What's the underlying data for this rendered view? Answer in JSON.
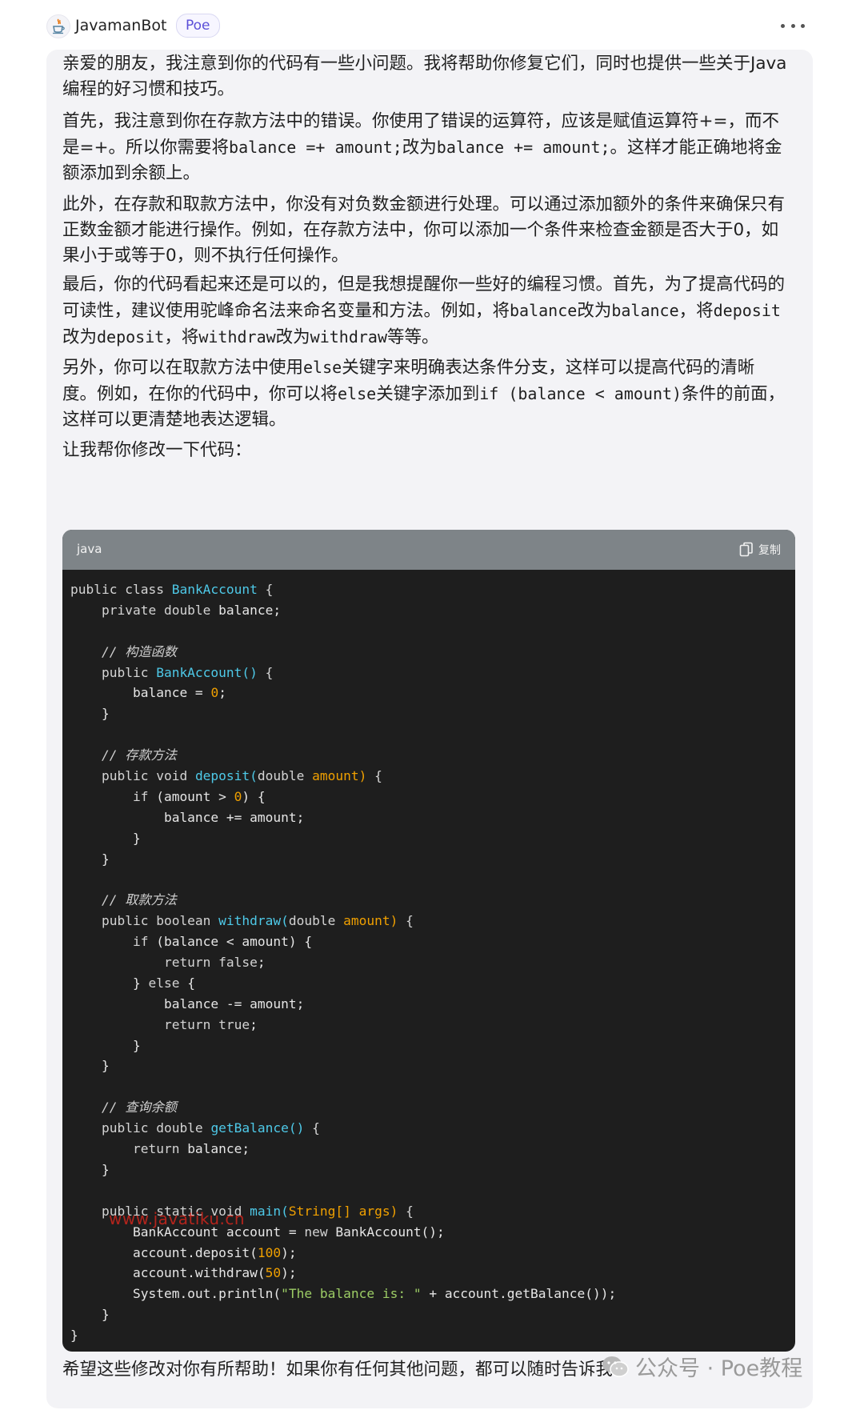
{
  "header": {
    "bot_name": "JavamanBot",
    "badge": "Poe"
  },
  "message": {
    "paragraphs": [
      [
        "亲爱的朋友，我注意到你的代码有一些小问题。我将帮助你修复它们，同时也提供一些关于Java编程的好习惯和技巧。"
      ],
      [
        "首先，我注意到你在存款方法中的错误。你使用了错误的运算符，应该是赋值运算符+=，而不是=+。所以你需要将",
        "balance =+ amount;",
        "改为",
        "balance += amount;",
        "。这样才能正确地将金额添加到余额上。"
      ],
      [
        "此外，在存款和取款方法中，你没有对负数金额进行处理。可以通过添加额外的条件来确保只有正数金额才能进行操作。例如，在存款方法中，你可以添加一个条件来检查金额是否大于0，如果小于或等于0，则不执行任何操作。"
      ],
      [
        "最后，你的代码看起来还是可以的，但是我想提醒你一些好的编程习惯。首先，为了提高代码的可读性，建议使用驼峰命名法来命名变量和方法。例如，将",
        "balance",
        "改为",
        "balance",
        "，将",
        "deposit",
        "改为",
        "deposit",
        "，将",
        "withdraw",
        "改为",
        "withdraw",
        "等等。"
      ],
      [
        "另外，你可以在取款方法中使用",
        "else",
        "关键字来明确表达条件分支，这样可以提高代码的清晰度。例如，在你的代码中，你可以将",
        "else",
        "关键字添加到",
        "if (balance < amount)",
        "条件的前面，这样可以更清楚地表达逻辑。"
      ],
      [
        "让我帮你修改一下代码："
      ],
      [
        "希望这些修改对你有所帮助！如果你有任何其他问题，都可以随时告诉我。"
      ]
    ]
  },
  "code": {
    "language": "java",
    "copy_label": "复制",
    "lines": [
      [
        [
          "kw",
          "public class "
        ],
        [
          "fn",
          "BankAccount"
        ],
        [
          "kw",
          " {"
        ]
      ],
      [
        [
          "kw",
          "    private double "
        ],
        [
          "",
          "balance;"
        ]
      ],
      [],
      [
        [
          "cmt",
          "    // 构造函数"
        ]
      ],
      [
        [
          "kw",
          "    public "
        ],
        [
          "fn",
          "BankAccount()"
        ],
        [
          "kw",
          " {"
        ]
      ],
      [
        [
          "",
          "        balance = "
        ],
        [
          "num",
          "0"
        ],
        [
          "",
          "; "
        ]
      ],
      [
        [
          "",
          "    }"
        ]
      ],
      [],
      [
        [
          "cmt",
          "    // 存款方法"
        ]
      ],
      [
        [
          "kw",
          "    public void "
        ],
        [
          "fn",
          "deposit("
        ],
        [
          "kw",
          "double "
        ],
        [
          "param",
          "amount)"
        ],
        [
          "kw",
          " {"
        ]
      ],
      [
        [
          "kw",
          "        if "
        ],
        [
          "",
          "(amount > "
        ],
        [
          "num",
          "0"
        ],
        [
          "",
          ") {"
        ]
      ],
      [
        [
          "",
          "            balance += amount;"
        ]
      ],
      [
        [
          "",
          "        }"
        ]
      ],
      [
        [
          "",
          "    }"
        ]
      ],
      [],
      [
        [
          "cmt",
          "    // 取款方法"
        ]
      ],
      [
        [
          "kw",
          "    public boolean "
        ],
        [
          "fn",
          "withdraw("
        ],
        [
          "kw",
          "double "
        ],
        [
          "param",
          "amount)"
        ],
        [
          "kw",
          " {"
        ]
      ],
      [
        [
          "kw",
          "        if "
        ],
        [
          "",
          "(balance < amount) {"
        ]
      ],
      [
        [
          "kw",
          "            return false"
        ],
        [
          "",
          ";"
        ]
      ],
      [
        [
          "",
          "        } "
        ],
        [
          "kw",
          "else"
        ],
        [
          "",
          " {"
        ]
      ],
      [
        [
          "",
          "            balance -= amount;"
        ]
      ],
      [
        [
          "kw",
          "            return true"
        ],
        [
          "",
          ";"
        ]
      ],
      [
        [
          "",
          "        }"
        ]
      ],
      [
        [
          "",
          "    }"
        ]
      ],
      [],
      [
        [
          "cmt",
          "    // 查询余额"
        ]
      ],
      [
        [
          "kw",
          "    public double "
        ],
        [
          "fn",
          "getBalance()"
        ],
        [
          "kw",
          " {"
        ]
      ],
      [
        [
          "kw",
          "        return "
        ],
        [
          "",
          "balance;"
        ]
      ],
      [
        [
          "",
          "    }"
        ]
      ],
      [],
      [
        [
          "kw",
          "    public static void "
        ],
        [
          "fn",
          "main("
        ],
        [
          "param",
          "String[] args)"
        ],
        [
          "kw",
          " {"
        ]
      ],
      [
        [
          "",
          "        BankAccount account = "
        ],
        [
          "kw",
          "new "
        ],
        [
          "",
          "BankAccount();"
        ]
      ],
      [
        [
          "",
          "        account.deposit("
        ],
        [
          "num",
          "100"
        ],
        [
          "",
          ");"
        ]
      ],
      [
        [
          "",
          "        account.withdraw("
        ],
        [
          "num",
          "50"
        ],
        [
          "",
          ");"
        ]
      ],
      [
        [
          "",
          "        System.out.println("
        ],
        [
          "str",
          "\"The balance is: \""
        ],
        [
          "",
          " + account.getBalance());"
        ]
      ],
      [
        [
          "",
          "    }"
        ]
      ],
      [
        [
          "",
          "}"
        ]
      ]
    ]
  },
  "watermark": {
    "url": "www.javatiku.cn",
    "brand": "公众号 · Poe教程"
  },
  "colors": {
    "bubble_bg": "#f3f3f6",
    "code_bg": "#1e1e1e",
    "code_header_bg": "#7e8488",
    "badge_text": "#5b4fd8"
  }
}
